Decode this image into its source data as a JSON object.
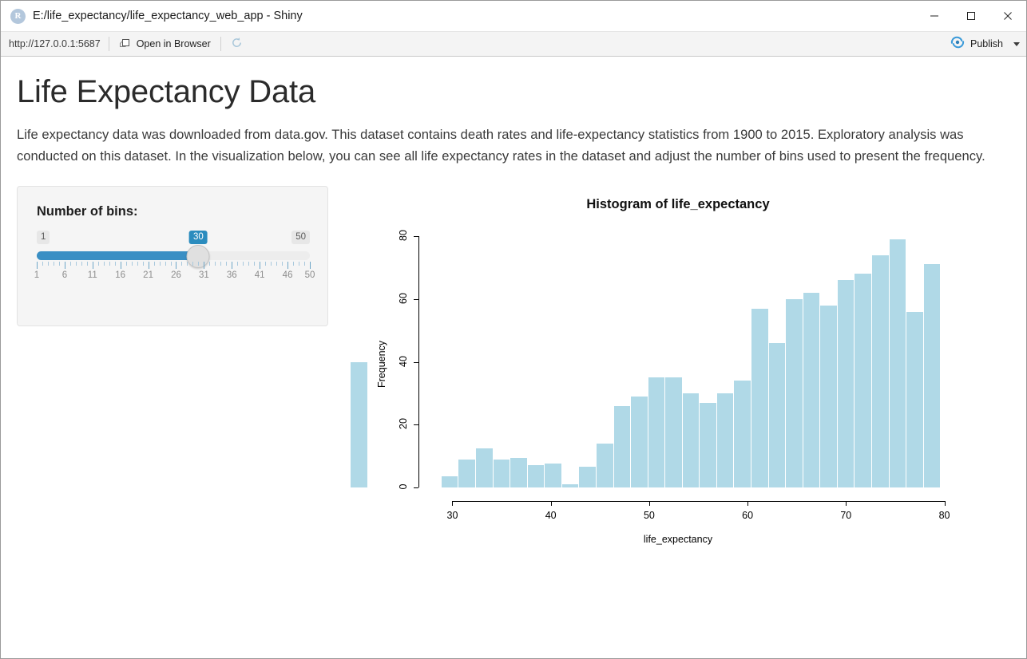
{
  "window": {
    "title": "E:/life_expectancy/life_expectancy_web_app - Shiny",
    "app_icon": "r-logo-icon",
    "buttons": {
      "minimize": "minimize-icon",
      "maximize": "maximize-icon",
      "close": "close-icon"
    }
  },
  "toolbar": {
    "url": "http://127.0.0.1:5687",
    "open_in_browser": "Open in Browser",
    "open_in_browser_icon": "external-window-icon",
    "refresh_icon": "refresh-icon",
    "publish_label": "Publish",
    "publish_icon": "publish-icon",
    "publish_caret_icon": "chevron-down-icon"
  },
  "page": {
    "title": "Life Expectancy Data",
    "intro": "Life expectancy data was downloaded from data.gov. This dataset contains death rates and life-expectancy statistics from 1900 to 2015. Exploratory analysis was conducted on this dataset. In the visualization below, you can see all life expectancy rates in the dataset and adjust the number of bins used to present the frequency."
  },
  "sidebar": {
    "slider": {
      "label": "Number of bins:",
      "min": 1,
      "max": 50,
      "value": 30,
      "min_label": "1",
      "max_label": "50",
      "value_label": "30",
      "tick_labels": [
        "1",
        "6",
        "11",
        "16",
        "21",
        "26",
        "31",
        "36",
        "41",
        "46",
        "50"
      ],
      "tick_values": [
        1,
        6,
        11,
        16,
        21,
        26,
        31,
        36,
        41,
        46,
        50
      ],
      "accent_color": "#3a8fc4",
      "track_color": "#ededed"
    }
  },
  "chart_data": {
    "type": "bar",
    "title": "Histogram of life_expectancy",
    "xlabel": "life_expectancy",
    "ylabel": "Frequency",
    "xlim": [
      28.5,
      81.5
    ],
    "ylim": [
      0,
      80
    ],
    "xticks": [
      30,
      40,
      50,
      60,
      70,
      80
    ],
    "yticks": [
      0,
      20,
      40,
      60,
      80
    ],
    "grid": false,
    "bar_color": "#b0d9e7",
    "bin_width": 1.75,
    "bin_starts": [
      28.9,
      30.65,
      32.4,
      34.15,
      35.9,
      37.65,
      39.4,
      41.15,
      42.9,
      44.65,
      46.4,
      48.15,
      49.9,
      51.65,
      53.4,
      55.15,
      56.9,
      58.65,
      60.4,
      62.15,
      63.9,
      65.65,
      67.4,
      69.15,
      70.9,
      72.65,
      74.4,
      76.15,
      77.9
    ],
    "categories": [
      "28.9",
      "30.7",
      "32.4",
      "34.2",
      "35.9",
      "37.7",
      "39.4",
      "41.2",
      "42.9",
      "44.7",
      "46.4",
      "48.2",
      "49.9",
      "51.7",
      "53.4",
      "55.2",
      "56.9",
      "58.7",
      "60.4",
      "62.2",
      "63.9",
      "65.7",
      "67.4",
      "69.2",
      "70.9",
      "72.7",
      "74.4",
      "76.2",
      "77.9"
    ],
    "values": [
      3.5,
      9,
      12.5,
      9,
      9.5,
      7,
      7.5,
      1,
      6.5,
      14,
      26,
      29,
      35,
      35,
      30,
      27,
      30,
      34,
      57,
      46,
      60,
      62,
      58,
      66,
      68,
      74,
      79,
      56,
      71,
      40
    ]
  }
}
